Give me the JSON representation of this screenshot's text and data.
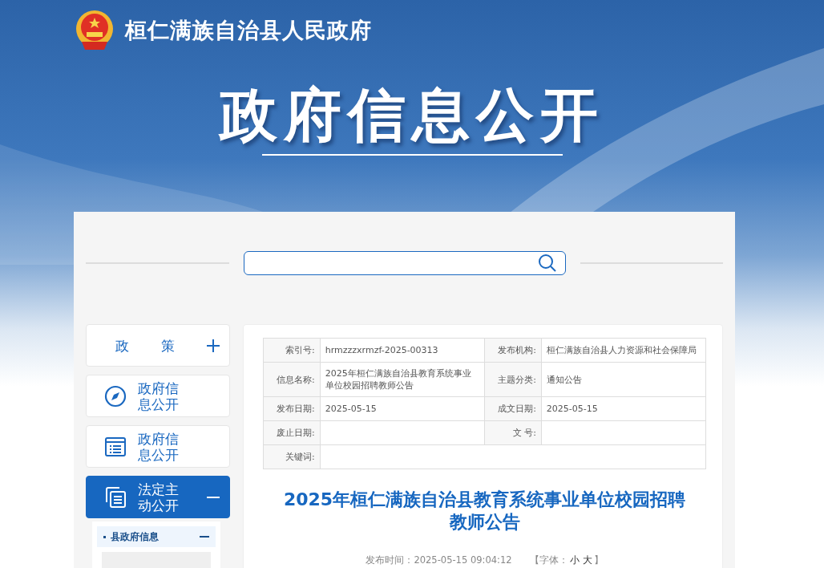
{
  "header": {
    "site_title": "桓仁满族自治县人民政府",
    "banner_title": "政府信息公开"
  },
  "sidebar": {
    "items": [
      {
        "label": "政策",
        "kind": "group",
        "expanded": false,
        "selected": false
      },
      {
        "label": "政府信息公开",
        "kind": "link",
        "selected": false
      },
      {
        "label": "政府信息公开",
        "kind": "link",
        "selected": false
      },
      {
        "label": "法定主动公开",
        "kind": "group",
        "expanded": true,
        "selected": true
      }
    ],
    "subitems": [
      {
        "label": "县政府信息",
        "expanded": true,
        "selected": true
      }
    ]
  },
  "info_table": {
    "rows": [
      [
        {
          "label": "索引号:",
          "value": "hrmzzzxrmzf-2025-00313"
        },
        {
          "label": "发布机构:",
          "value": "桓仁满族自治县人力资源和社会保障局"
        }
      ],
      [
        {
          "label": "信息名称:",
          "value": "2025年桓仁满族自治县教育系统事业单位校园招聘教师公告"
        },
        {
          "label": "主题分类:",
          "value": "通知公告"
        }
      ],
      [
        {
          "label": "发布日期:",
          "value": "2025-05-15"
        },
        {
          "label": "成文日期:",
          "value": "2025-05-15"
        }
      ],
      [
        {
          "label": "废止日期:"
        },
        {
          "label": "文 号:"
        }
      ],
      [
        {
          "label": "关键词:"
        }
      ]
    ]
  },
  "article": {
    "title": "2025年桓仁满族自治县教育系统事业单位校园招聘教师公告",
    "published": "发布时间：2025-05-15 09:04:12",
    "font_label": "【字体：",
    "font_sizes": [
      "小",
      "大"
    ],
    "font_close": "】"
  }
}
